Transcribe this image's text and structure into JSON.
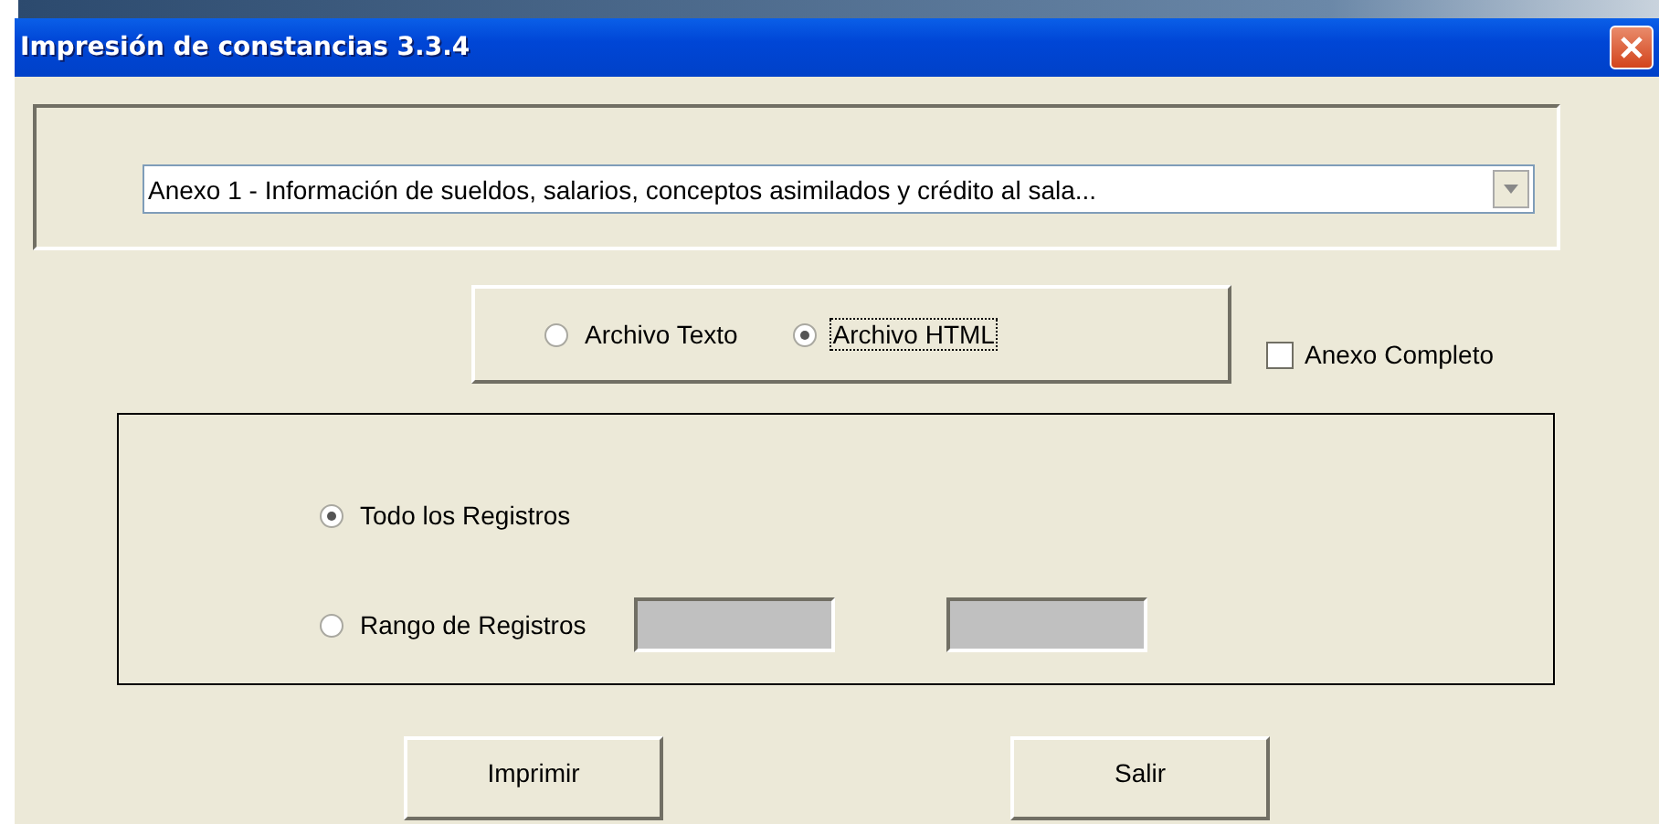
{
  "window": {
    "title": "Impresión de constancias 3.3.4"
  },
  "annex_select": {
    "value": "Anexo 1 - Información de sueldos, salarios, conceptos asimilados y crédito al sala..."
  },
  "format_options": [
    {
      "label": "Archivo Texto",
      "selected": false,
      "focused": false
    },
    {
      "label": "Archivo HTML",
      "selected": true,
      "focused": true
    }
  ],
  "complete_annex": {
    "label": "Anexo Completo",
    "checked": false
  },
  "record_options": [
    {
      "label": "Todo los Registros",
      "selected": true,
      "kind": "plain"
    },
    {
      "label": "Rango de Registros",
      "selected": false,
      "kind": "range",
      "range_fields": [
        {
          "disabled": true
        },
        {
          "disabled": true
        }
      ]
    }
  ],
  "buttons": [
    {
      "label": "Imprimir"
    },
    {
      "label": "Salir"
    }
  ]
}
